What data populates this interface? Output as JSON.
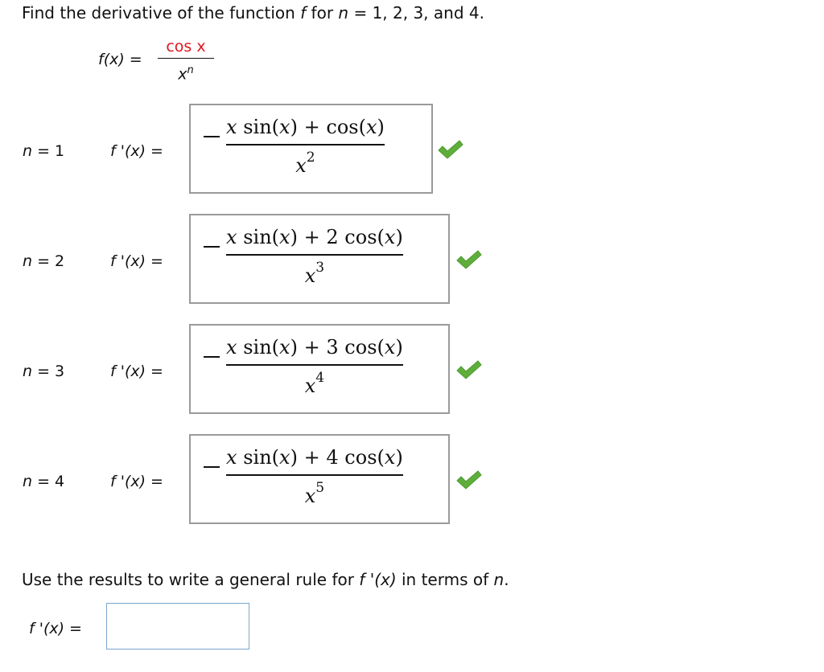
{
  "prompt": {
    "prefix": "Find the derivative of the function ",
    "f_symbol": "f",
    "mid": " for ",
    "n_symbol": "n",
    "suffix": " = 1, 2, 3, and 4."
  },
  "function_definition": {
    "lhs": "f(x) = ",
    "numerator": "cos x",
    "denominator_base": "x",
    "denominator_exponent": "n"
  },
  "rows": [
    {
      "n_label": "n",
      "n_value": " = 1",
      "f_label": "f '(x) =",
      "sign": "−",
      "numerator_parts": [
        "x",
        " sin",
        "(",
        "x",
        ")",
        " + ",
        "cos",
        "(",
        "x",
        ")"
      ],
      "numerator_text": "x sin(x) + cos(x)",
      "denominator_base": "x",
      "denominator_exponent": "2",
      "status": "correct",
      "status_icon": "checkmark-icon"
    },
    {
      "n_label": "n",
      "n_value": " = 2",
      "f_label": "f '(x) =",
      "sign": "−",
      "numerator_text": "x sin(x) + 2 cos(x)",
      "denominator_base": "x",
      "denominator_exponent": "3",
      "status": "correct",
      "status_icon": "checkmark-icon"
    },
    {
      "n_label": "n",
      "n_value": " = 3",
      "f_label": "f '(x) =",
      "sign": "−",
      "numerator_text": "x sin(x) + 3 cos(x)",
      "denominator_base": "x",
      "denominator_exponent": "4",
      "status": "correct",
      "status_icon": "checkmark-icon"
    },
    {
      "n_label": "n",
      "n_value": " = 4",
      "f_label": "f '(x) =",
      "sign": "−",
      "numerator_text": "x sin(x) + 4 cos(x)",
      "denominator_base": "x",
      "denominator_exponent": "5",
      "status": "correct",
      "status_icon": "checkmark-icon"
    }
  ],
  "general_rule": {
    "prefix": "Use the results to write a general rule for ",
    "f_expr": "f '(x)",
    "mid": " in terms of ",
    "n_symbol": "n",
    "suffix": ".",
    "answer_label": "f '(x) =",
    "answer_value": "",
    "answer_placeholder": ""
  },
  "colors": {
    "numerator_red": "#e0141e",
    "check_green": "#5fae3c",
    "answer_box_border": "#9a9a9a",
    "input_border": "#7ba7cf"
  }
}
